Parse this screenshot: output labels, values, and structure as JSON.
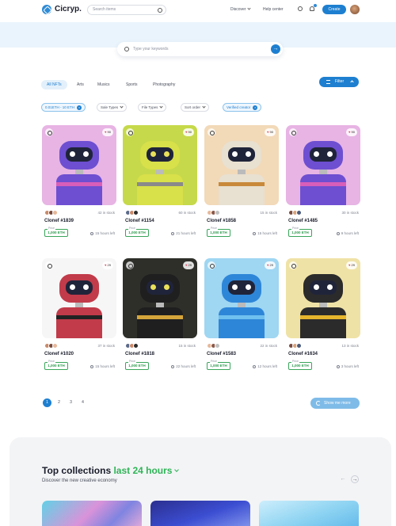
{
  "header": {
    "logo_text": "Cicryp.",
    "search_placeholder": "Search items",
    "nav_discover": "Discover",
    "nav_help": "Help center",
    "create_label": "Create"
  },
  "hero": {
    "search_placeholder": "Type your keywords",
    "go_symbol": "→"
  },
  "tabs": [
    "All NFTs",
    "Arts",
    "Musics",
    "Sports",
    "Photography"
  ],
  "filter_label": "Filter",
  "chips": [
    "0.01ETH - 10 ETH",
    "Sale Types",
    "File Types",
    "Sort order",
    "Verified creator"
  ],
  "chip_close_symbol": "×",
  "price_label": "Price",
  "cards": [
    {
      "name": "Clonef #1839",
      "stock": "42 in stock",
      "likes": "90",
      "price": "1,000 ETH",
      "time": "15 hours left"
    },
    {
      "name": "Clonef #1154",
      "stock": "60 in stock",
      "likes": "90",
      "price": "1,000 ETH",
      "time": "21 hours left"
    },
    {
      "name": "Clonef #1858",
      "stock": "15 in stock",
      "likes": "90",
      "price": "1,000 ETH",
      "time": "15 hours left"
    },
    {
      "name": "Clonef #1485",
      "stock": "30 in stock",
      "likes": "90",
      "price": "1,000 ETH",
      "time": "9 hours left"
    },
    {
      "name": "Clonef #1020",
      "stock": "37 in stock",
      "likes": "29",
      "price": "1,000 ETH",
      "time": "15 hours left"
    },
    {
      "name": "Clonef #1818",
      "stock": "15 in stock",
      "likes": "29",
      "price": "1,000 ETH",
      "time": "22 hours left"
    },
    {
      "name": "Clonef #1583",
      "stock": "22 in stock",
      "likes": "29",
      "price": "1,000 ETH",
      "time": "12 hours left"
    },
    {
      "name": "Clonef #1634",
      "stock": "13 in stock",
      "likes": "29",
      "price": "1,000 ETH",
      "time": "3 hours left"
    }
  ],
  "card_colors": [
    "#e7b4e4",
    "#c6d94a",
    "#f2d9b8",
    "#e7b4e4",
    "#f6f6f6",
    "#2f2f2a",
    "#9fd6f2",
    "#efe2a6"
  ],
  "pagination": [
    "1",
    "2",
    "3",
    "4"
  ],
  "show_more_label": "Show me more",
  "collections": {
    "title_start": "Top collections ",
    "title_highlight": "last 24 hours",
    "subtitle": "Discover the new creative economy",
    "prev_symbol": "←",
    "next_symbol": "→"
  },
  "colors": {
    "accent": "#1e7fd0",
    "green": "#2fb457",
    "hero_bg": "#eaf4fc"
  }
}
